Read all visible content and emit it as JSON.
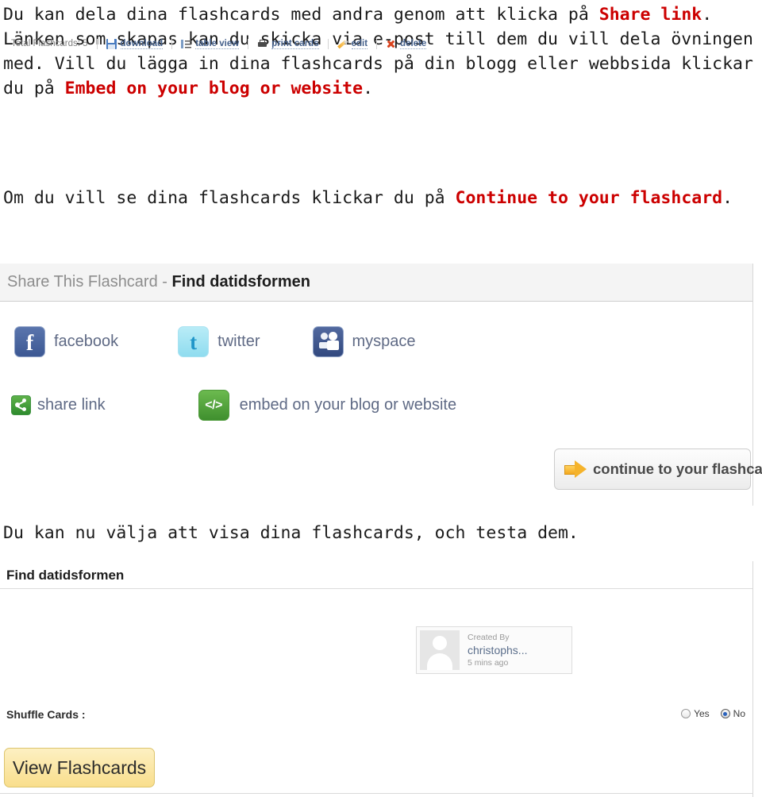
{
  "instructions": {
    "para1": {
      "segment1": "Du kan dela dina flashcards med andra genom att klicka på ",
      "highlight1": "Share link",
      "segment2": ". Länken som skapas kan du skicka via e-post till dem du vill dela övningen med. Vill du lägga in dina flashcards på din blogg eller webbsida klickar du på ",
      "highlight2": "Embed on your blog or website",
      "segment3": "."
    },
    "para2": {
      "segment1": "Om du vill se dina flashcards klickar du på ",
      "highlight1": "Continue to your flashcard",
      "segment2": "."
    },
    "para3": {
      "text": "Du kan nu välja att visa dina flashcards, och testa dem."
    },
    "highlight_color": "#cc0000"
  },
  "share_panel": {
    "header": {
      "prefix": "Share This Flashcard",
      "separator": " - ",
      "deck_name": "Find datidsformen"
    },
    "social": [
      {
        "icon": "facebook-icon",
        "label": "facebook"
      },
      {
        "icon": "twitter-icon",
        "label": "twitter"
      },
      {
        "icon": "myspace-icon",
        "label": "myspace"
      }
    ],
    "links": [
      {
        "icon": "share-link-icon",
        "label": "share link"
      },
      {
        "icon": "embed-code-icon",
        "icon_glyph": "</>",
        "label": "embed on your blog or website"
      }
    ],
    "continue_button": {
      "icon": "arrow-right-icon",
      "label": "continue to your flashcard"
    },
    "colors": {
      "facebook": "#3c5893",
      "twitter": "#8fdcef",
      "myspace": "#32497f",
      "share_link": "#2e8b2e",
      "embed": "#3f8f2e",
      "link_text": "#5f6a85"
    }
  },
  "deck_panel": {
    "title": "Find datidsformen",
    "toolbar": {
      "total_label": "Total Flashcards: 5",
      "actions": [
        {
          "icon": "download-icon",
          "label": "download"
        },
        {
          "icon": "table-view-icon",
          "label": "table view"
        },
        {
          "icon": "printer-icon",
          "label": "print cards"
        },
        {
          "icon": "pencil-icon",
          "label": "edit"
        },
        {
          "icon": "delete-x-icon",
          "label": "delete"
        }
      ]
    },
    "created_by": {
      "icon": "avatar-placeholder-icon",
      "label": "Created By",
      "username": "christophs...",
      "timestamp": "5 mins ago"
    },
    "shuffle": {
      "label": "Shuffle Cards :",
      "options": [
        {
          "label": "Yes",
          "selected": false
        },
        {
          "label": "No",
          "selected": true
        }
      ]
    },
    "view_button": {
      "label": "View Flashcards"
    },
    "colors": {
      "link_text": "#45618c",
      "button_bg": "#f9de8c",
      "radio_selected": "#2c63bd"
    }
  }
}
